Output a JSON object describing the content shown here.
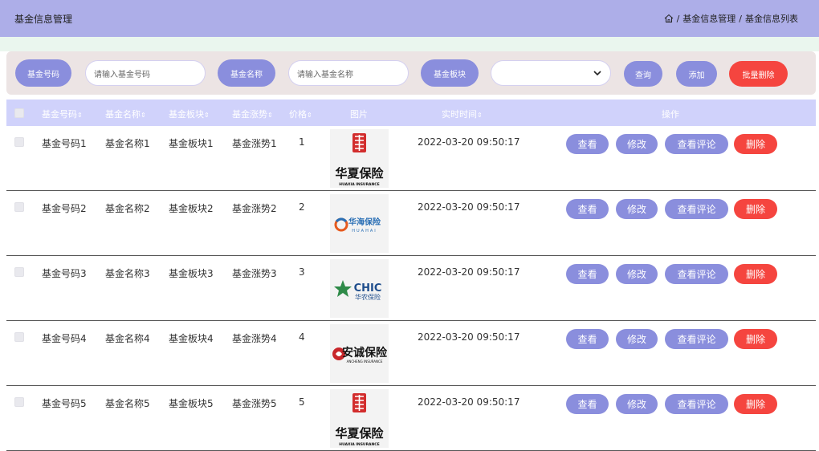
{
  "header": {
    "title": "基金信息管理",
    "breadcrumb": [
      "基金信息管理",
      "基金信息列表"
    ],
    "separator": "/"
  },
  "search": {
    "code_label": "基金号码",
    "code_placeholder": "请输入基金号码",
    "name_label": "基金名称",
    "name_placeholder": "请输入基金名称",
    "sector_label": "基金板块",
    "sector_value": "",
    "query_label": "查询",
    "add_label": "添加",
    "batch_delete_label": "批量删除"
  },
  "table": {
    "columns": [
      "基金号码",
      "基金名称",
      "基金板块",
      "基金涨势",
      "价格",
      "图片",
      "实时时间",
      "操作"
    ],
    "sort_glyph": "⇕",
    "actions": {
      "view": "查看",
      "edit": "修改",
      "comments": "查看评论",
      "delete": "删除"
    },
    "rows": [
      {
        "code": "基金号码1",
        "name": "基金名称1",
        "sector": "基金板块1",
        "trend": "基金涨势1",
        "price": "1",
        "time": "2022-03-20 09:50:17",
        "logo": "huaxia",
        "logo_cn": "华夏保险",
        "logo_en": "HUAXIA INSURANCE"
      },
      {
        "code": "基金号码2",
        "name": "基金名称2",
        "sector": "基金板块2",
        "trend": "基金涨势2",
        "price": "2",
        "time": "2022-03-20 09:50:17",
        "logo": "huahai",
        "logo_cn": "华海保险",
        "logo_en": "HUAHAI"
      },
      {
        "code": "基金号码3",
        "name": "基金名称3",
        "sector": "基金板块3",
        "trend": "基金涨势3",
        "price": "3",
        "time": "2022-03-20 09:50:17",
        "logo": "chic",
        "logo_cn": "华农保险",
        "logo_en": "CHIC"
      },
      {
        "code": "基金号码4",
        "name": "基金名称4",
        "sector": "基金板块4",
        "trend": "基金涨势4",
        "price": "4",
        "time": "2022-03-20 09:50:17",
        "logo": "ancheng",
        "logo_cn": "安诚保险",
        "logo_en": "ANCHENG INSURANCE"
      },
      {
        "code": "基金号码5",
        "name": "基金名称5",
        "sector": "基金板块5",
        "trend": "基金涨势5",
        "price": "5",
        "time": "2022-03-20 09:50:17",
        "logo": "huaxia",
        "logo_cn": "华夏保险",
        "logo_en": "HUAXIA INSURANCE"
      }
    ]
  },
  "colors": {
    "header_bg": "#adaee8",
    "accent": "#8a8edd",
    "danger": "#f5453f",
    "table_head_bg": "#d0d2fb"
  }
}
